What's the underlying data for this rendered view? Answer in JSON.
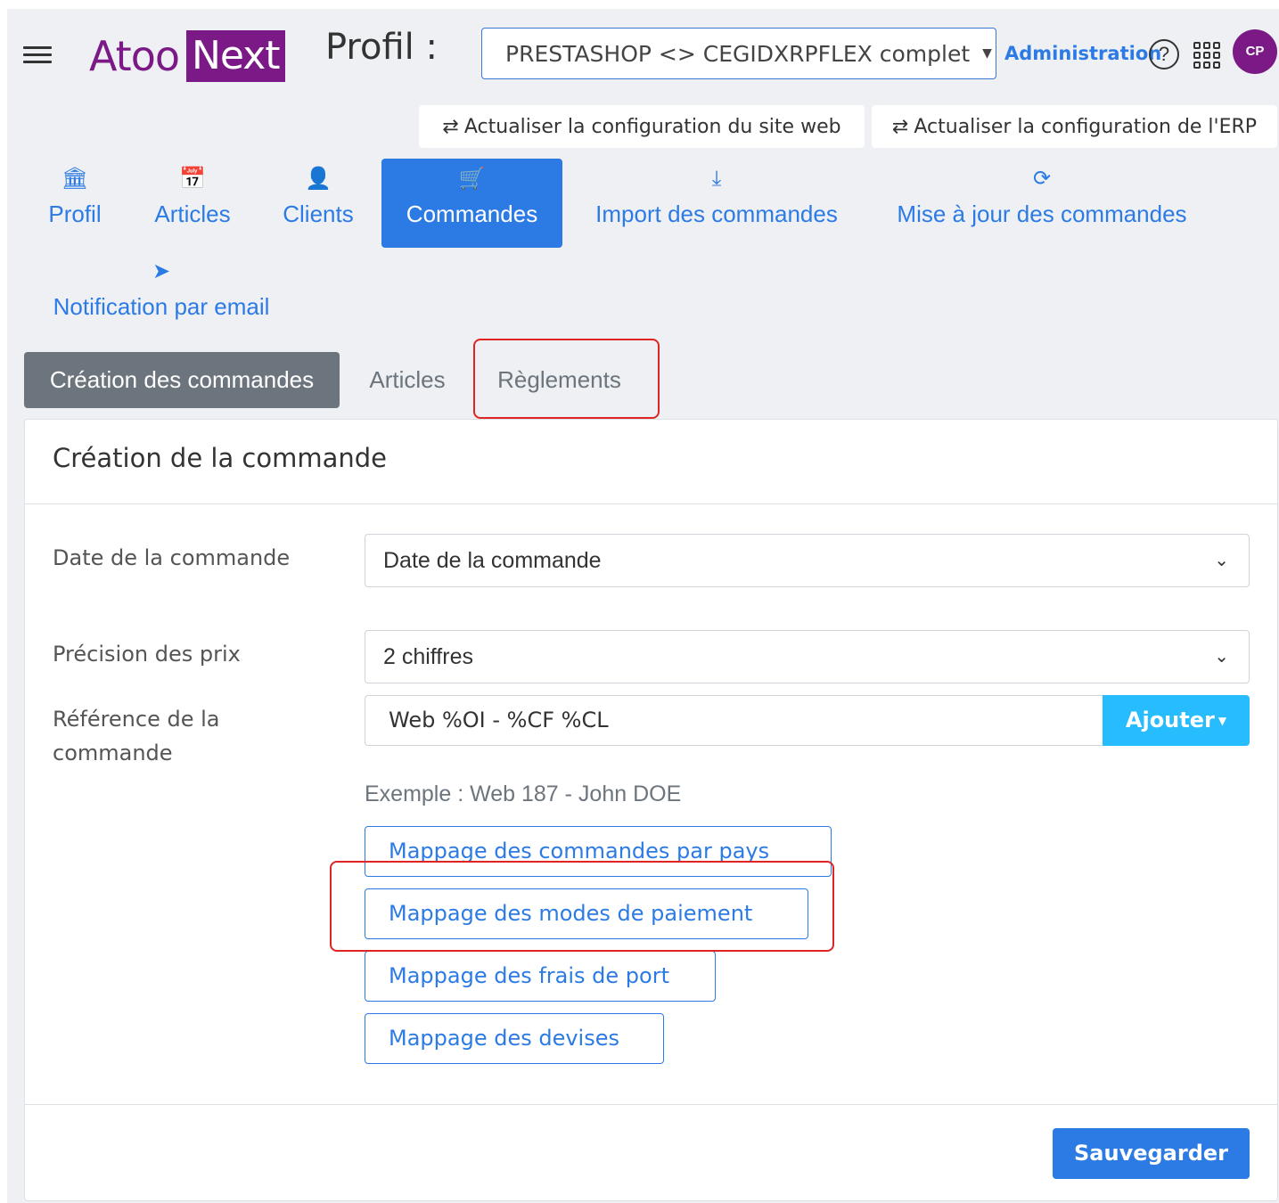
{
  "header": {
    "logo_part1": "Atoo",
    "logo_part2": "Next",
    "profil_label": "Profil :",
    "profile_selected": "PRESTASHOP <> CEGIDXRPFLEX complet",
    "admin_link": "Administration",
    "avatar_initials": "CP"
  },
  "actions": {
    "refresh_web": "Actualiser la configuration du site web",
    "refresh_erp": "Actualiser la configuration de l'ERP"
  },
  "nav": {
    "profil": "Profil",
    "articles": "Articles",
    "clients": "Clients",
    "commandes": "Commandes",
    "import": "Import des commandes",
    "maj": "Mise à jour des commandes",
    "notification": "Notification par email"
  },
  "subtabs": {
    "creation": "Création des commandes",
    "articles": "Articles",
    "reglements": "Règlements"
  },
  "card": {
    "title": "Création de la commande",
    "date_label": "Date de la commande",
    "date_value": "Date de la commande",
    "precision_label": "Précision des prix",
    "precision_value": "2 chiffres",
    "reference_label": "Référence de la commande",
    "reference_value": "Web %OI - %CF %CL",
    "ajouter": "Ajouter",
    "example": "Exemple : Web 187 - John DOE",
    "map_pays": "Mappage des commandes par pays",
    "map_paiement": "Mappage des modes de paiement",
    "map_port": "Mappage des frais de port",
    "map_devises": "Mappage des devises",
    "save": "Sauvegarder"
  },
  "colors": {
    "brand": "#7b1a86",
    "primary": "#2c7be5",
    "info": "#27bcfd",
    "secondary": "#6c757d",
    "highlight": "#e02424"
  }
}
